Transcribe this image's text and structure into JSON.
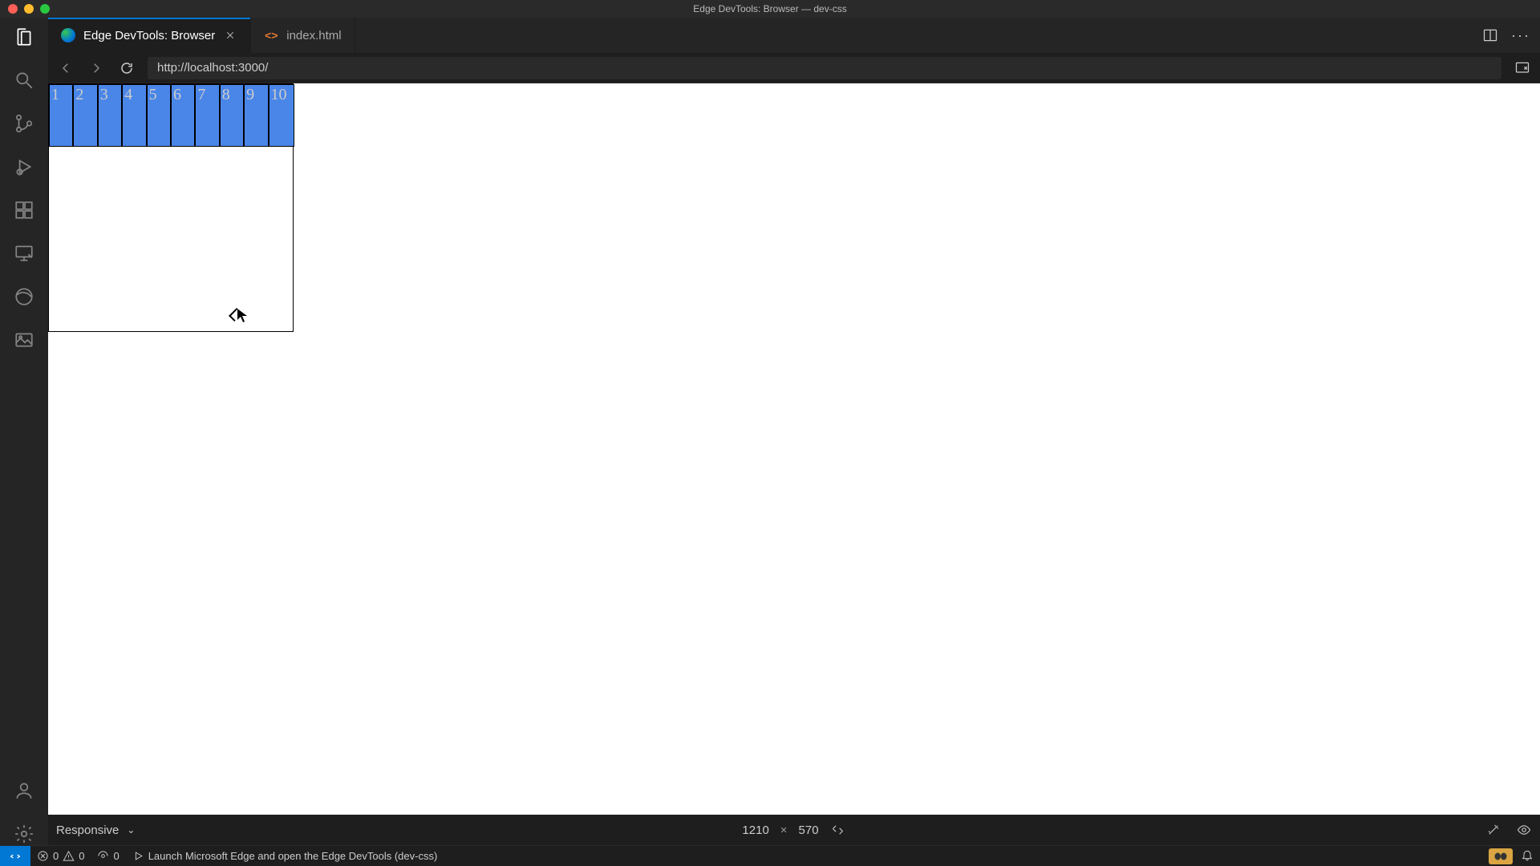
{
  "window": {
    "title": "Edge DevTools: Browser — dev-css"
  },
  "tabs": {
    "active": {
      "label": "Edge DevTools: Browser"
    },
    "second": {
      "label": "index.html"
    }
  },
  "nav": {
    "url": "http://localhost:3000/"
  },
  "page": {
    "cells": [
      "1",
      "2",
      "3",
      "4",
      "5",
      "6",
      "7",
      "8",
      "9",
      "10"
    ]
  },
  "device": {
    "mode": "Responsive",
    "width": "1210",
    "x": "×",
    "height": "570"
  },
  "status": {
    "errors": "0",
    "warnings": "0",
    "ports": "0",
    "launch": "Launch Microsoft Edge and open the Edge DevTools (dev-css)"
  }
}
